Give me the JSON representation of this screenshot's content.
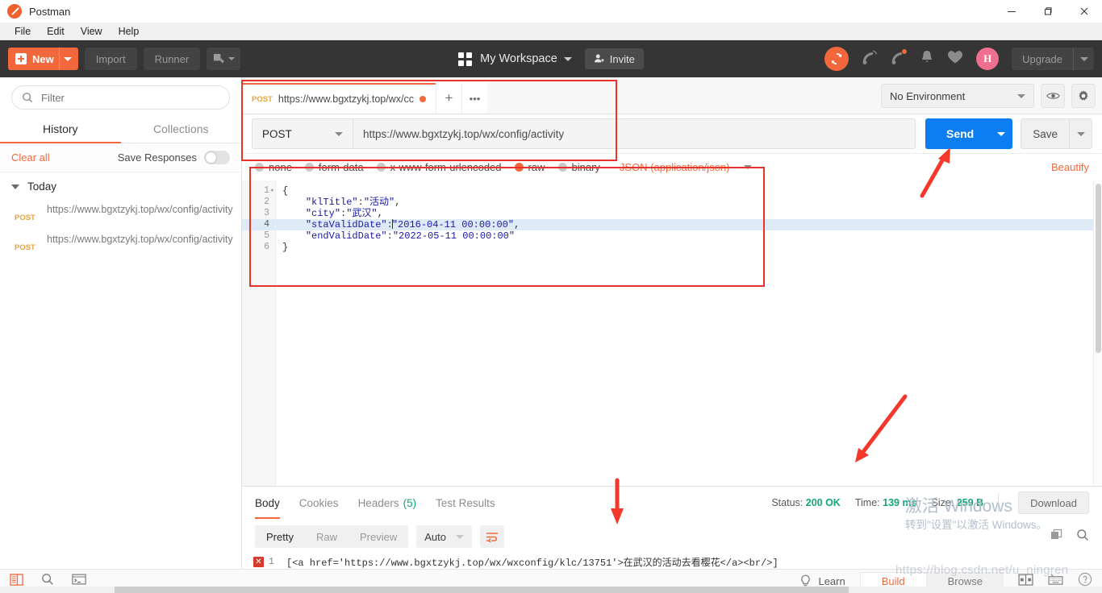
{
  "window": {
    "app_title": "Postman",
    "minimize": "—",
    "maximize": "❐",
    "close": "✕"
  },
  "menubar": {
    "items": [
      "File",
      "Edit",
      "View",
      "Help"
    ]
  },
  "toolbar": {
    "new_label": "New",
    "import_label": "Import",
    "runner_label": "Runner",
    "workspace_label": "My Workspace",
    "invite_label": "Invite",
    "upgrade_label": "Upgrade",
    "avatar_initial": "H"
  },
  "sidebar": {
    "filter_placeholder": "Filter",
    "tabs": [
      {
        "label": "History",
        "active": true
      },
      {
        "label": "Collections",
        "active": false
      }
    ],
    "clear_all": "Clear all",
    "save_responses_label": "Save Responses",
    "group_label": "Today",
    "items": [
      {
        "method": "POST",
        "url": "https://www.bgxtzykj.top/wx/config/activity"
      },
      {
        "method": "POST",
        "url": "https://www.bgxtzykj.top/wx/config/activity"
      }
    ]
  },
  "request_tab": {
    "method": "POST",
    "url_short": "https://www.bgxtzykj.top/wx/cc",
    "add_label": "+",
    "more_label": "•••"
  },
  "environment": {
    "selected": "No Environment"
  },
  "request": {
    "method": "POST",
    "url": "https://www.bgxtzykj.top/wx/config/activity",
    "send_label": "Send",
    "save_label": "Save"
  },
  "body_type": {
    "options": [
      {
        "label": "none",
        "selected": false
      },
      {
        "label": "form-data",
        "selected": false
      },
      {
        "label": "x-www-form-urlencoded",
        "selected": false
      },
      {
        "label": "raw",
        "selected": true
      },
      {
        "label": "binary",
        "selected": false
      }
    ],
    "content_type": "JSON (application/json)",
    "beautify": "Beautify"
  },
  "editor": {
    "line_numbers": [
      "1",
      "2",
      "3",
      "4",
      "5",
      "6"
    ],
    "highlight_line": 4,
    "lines": [
      {
        "n": 1,
        "text": "{"
      },
      {
        "n": 2,
        "key": "\"klTitle\"",
        "sep": ":",
        "value": "\"活动\"",
        "tail": ",",
        "indent": 4
      },
      {
        "n": 3,
        "key": "\"city\"",
        "sep": ":",
        "value": "\"武汉\"",
        "tail": ",",
        "indent": 4
      },
      {
        "n": 4,
        "key": "\"staValidDate\"",
        "sep": ":",
        "value": "\"2016-04-11 00:00:00\"",
        "tail": ",",
        "indent": 4
      },
      {
        "n": 5,
        "key": "\"endValidDate\"",
        "sep": ":",
        "value": "\"2022-05-11 00:00:00\"",
        "tail": "",
        "indent": 4
      },
      {
        "n": 6,
        "text": "}"
      }
    ]
  },
  "response": {
    "tabs": [
      {
        "label": "Body",
        "active": true,
        "count": null
      },
      {
        "label": "Cookies",
        "active": false,
        "count": null
      },
      {
        "label": "Headers",
        "active": false,
        "count": "(5)"
      },
      {
        "label": "Test Results",
        "active": false,
        "count": null
      }
    ],
    "status_label": "Status:",
    "status_value": "200 OK",
    "time_label": "Time:",
    "time_value": "139 ms",
    "size_label": "Size:",
    "size_value": "259 B",
    "download_label": "Download",
    "view_modes": [
      {
        "label": "Pretty",
        "active": true
      },
      {
        "label": "Raw",
        "active": false
      },
      {
        "label": "Preview",
        "active": false
      }
    ],
    "format_selected": "Auto",
    "line_number": "1",
    "error_marker": "✕",
    "body_text": "[<a href='https://www.bgxtzykj.top/wx/wxconfig/klc/13751'>在武汉的活动去看樱花</a><br/>]"
  },
  "statusbar": {
    "learn_label": "Learn",
    "build_label": "Build",
    "browse_label": "Browse"
  },
  "watermark": {
    "line1": "激活 Windows",
    "line2": "转到\"设置\"以激活 Windows。",
    "csdn": "https://blog.csdn.net/u_ningren"
  },
  "colors": {
    "accent": "#f2683c",
    "send": "#0d7ef2",
    "success": "#12a67a",
    "method": "#e8a33d",
    "annotation": "#e8332a"
  }
}
